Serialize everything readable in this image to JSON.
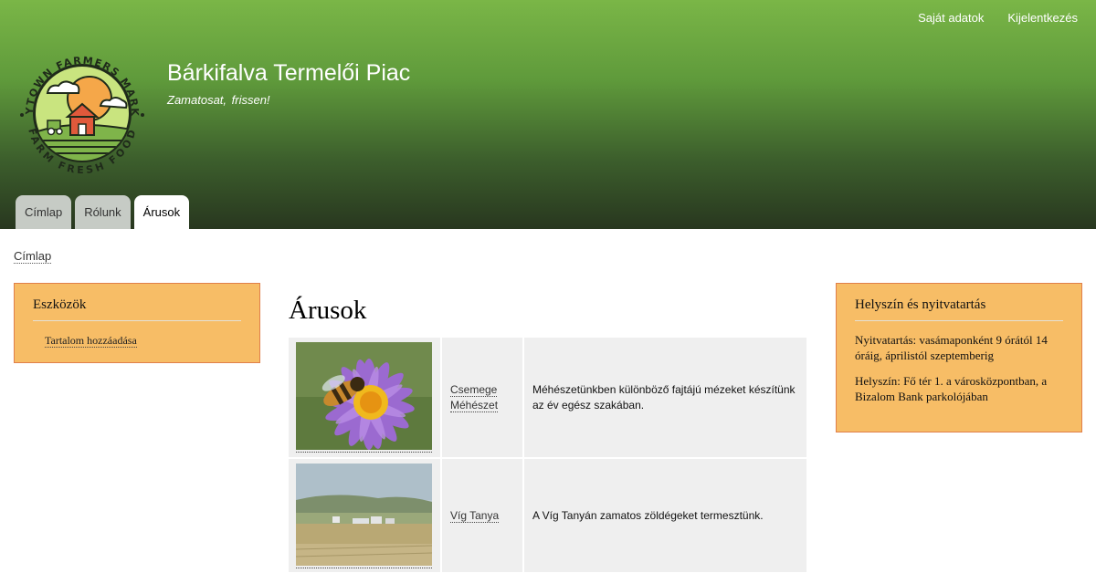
{
  "header": {
    "site_name": "Bárkifalva Termelői Piac",
    "slogan": "Zamatosat,  frissen!",
    "logo": {
      "top_text": "ANYTOWN FARMERS MARKET",
      "bottom_text": "FARM FRESH FOOD",
      "icon": "farm-logo"
    },
    "secondary_menu": [
      {
        "label": "Saját adatok"
      },
      {
        "label": "Kijelentkezés"
      }
    ],
    "main_menu": [
      {
        "label": "Címlap",
        "active": false
      },
      {
        "label": "Rólunk",
        "active": false
      },
      {
        "label": "Árusok",
        "active": true
      }
    ]
  },
  "breadcrumb": {
    "home": "Címlap"
  },
  "sidebar_first": {
    "title": "Eszközök",
    "links": [
      {
        "label": "Tartalom hozzáadása"
      }
    ]
  },
  "sidebar_second": {
    "title": "Helyszín és nyitvatartás",
    "paragraphs": [
      "Nyitvatartás: vasámaponként 9 órától 14 óráig, áprilistól szeptemberig",
      "Helyszín: Fő tér 1. a városközpontban, a Bizalom Bank parkolójában"
    ]
  },
  "main": {
    "title": "Árusok",
    "vendors": [
      {
        "name": "Csemege Méhészet",
        "description": "Méhészetünkben különböző fajtájú mézeket készítünk az év egész szakában.",
        "image": "bee-on-flower-photo"
      },
      {
        "name": "Víg Tanya",
        "description": "A Víg Tanyán zamatos zöldégeket termesztünk.",
        "image": "farm-landscape-photo"
      }
    ]
  },
  "colors": {
    "header_top": "#7ab647",
    "header_bottom": "#28371f",
    "sidebar_block": "#f7bd66",
    "sidebar_border": "#e07f4a",
    "tab": "#c6cbc5"
  }
}
